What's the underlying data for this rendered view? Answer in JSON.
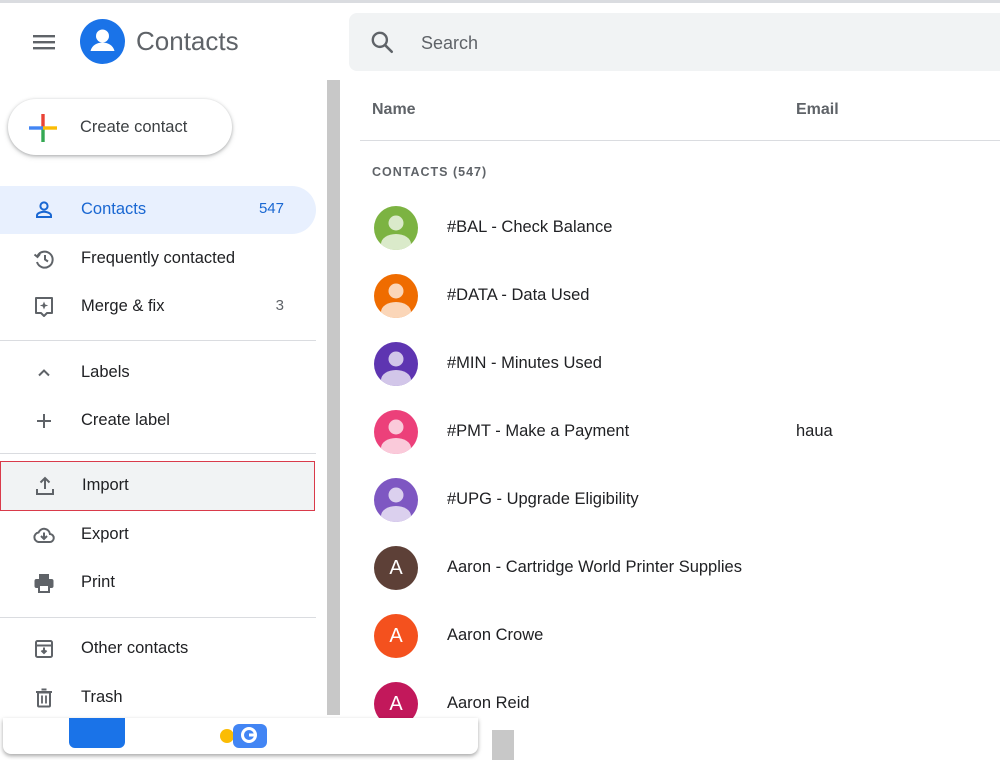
{
  "app": {
    "title": "Contacts"
  },
  "search": {
    "placeholder": "Search"
  },
  "create_button": {
    "label": "Create contact"
  },
  "sidebar": {
    "items": [
      {
        "label": "Contacts",
        "count": "547",
        "icon": "person-outline-icon",
        "active": true
      },
      {
        "label": "Frequently contacted",
        "count": "",
        "icon": "history-icon"
      },
      {
        "label": "Merge & fix",
        "count": "3",
        "icon": "merge-fix-icon"
      },
      {
        "label": "Labels",
        "count": "",
        "icon": "chevron-up-icon"
      },
      {
        "label": "Create label",
        "count": "",
        "icon": "plus-icon"
      },
      {
        "label": "Import",
        "count": "",
        "icon": "upload-icon",
        "highlighted": true
      },
      {
        "label": "Export",
        "count": "",
        "icon": "cloud-download-icon"
      },
      {
        "label": "Print",
        "count": "",
        "icon": "printer-icon"
      },
      {
        "label": "Other contacts",
        "count": "",
        "icon": "archive-icon"
      },
      {
        "label": "Trash",
        "count": "",
        "icon": "trash-icon"
      }
    ]
  },
  "list": {
    "columns": {
      "name": "Name",
      "email": "Email"
    },
    "section_label": "CONTACTS (547)",
    "rows": [
      {
        "name": "#BAL - Check Balance",
        "email": "",
        "avatar_color": "#7cb342",
        "avatar_type": "icon"
      },
      {
        "name": "#DATA - Data Used",
        "email": "",
        "avatar_color": "#ef6c00",
        "avatar_type": "icon"
      },
      {
        "name": "#MIN - Minutes Used",
        "email": "",
        "avatar_color": "#5e35b1",
        "avatar_type": "icon"
      },
      {
        "name": "#PMT - Make a Payment",
        "email": "haua",
        "avatar_color": "#ec407a",
        "avatar_type": "icon"
      },
      {
        "name": "#UPG - Upgrade Eligibility",
        "email": "",
        "avatar_color": "#7e57c2",
        "avatar_type": "icon"
      },
      {
        "name": "Aaron - Cartridge World Printer Supplies",
        "email": "",
        "avatar_color": "#5d4037",
        "avatar_type": "letter",
        "letter": "A"
      },
      {
        "name": "Aaron Crowe",
        "email": "",
        "avatar_color": "#f4511e",
        "avatar_type": "letter",
        "letter": "A"
      },
      {
        "name": "Aaron Reid",
        "email": "",
        "avatar_color": "#c2185b",
        "avatar_type": "letter",
        "letter": "A"
      }
    ]
  },
  "colors": {
    "accent": "#1a73e8",
    "active_bg": "#e8f0fe",
    "active_text": "#1967d2",
    "highlight_border": "#d93a4a"
  }
}
